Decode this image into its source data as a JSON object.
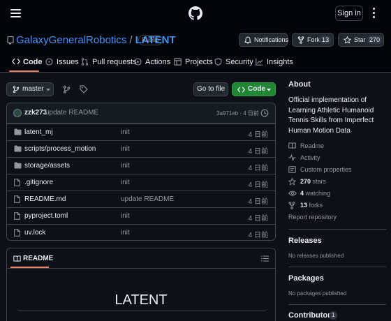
{
  "topbar": {
    "signin_label": "Sign in"
  },
  "repo": {
    "owner": "GalaxyGeneralRobotics",
    "separator": "/",
    "name": "LATENT",
    "visibility": "Public"
  },
  "header_buttons": {
    "notifications": "Notifications",
    "fork_label": "Fork",
    "fork_count": "13",
    "star_label": "Star",
    "star_count": "270"
  },
  "tabs": [
    {
      "label": "Code",
      "icon": "code-icon"
    },
    {
      "label": "Issues",
      "icon": "issue-icon"
    },
    {
      "label": "Pull requests",
      "icon": "pull-request-icon"
    },
    {
      "label": "Actions",
      "icon": "play-icon"
    },
    {
      "label": "Projects",
      "icon": "table-icon"
    },
    {
      "label": "Security",
      "icon": "shield-icon"
    },
    {
      "label": "Insights",
      "icon": "graph-icon"
    }
  ],
  "toolbar": {
    "branch": "master",
    "goto_file": "Go to file",
    "code_button": "Code"
  },
  "commit": {
    "author": "zzk273",
    "message": "update README",
    "hash": "3a971eb · 4 日前"
  },
  "files": [
    {
      "type": "folder",
      "name": "latent_mj",
      "message": "init",
      "date": "4 日前"
    },
    {
      "type": "folder",
      "name": "scripts/process_motion",
      "message": "init",
      "date": "4 日前"
    },
    {
      "type": "folder",
      "name": "storage/assets",
      "message": "init",
      "date": "4 日前"
    },
    {
      "type": "file",
      "name": ".gitignore",
      "message": "init",
      "date": "4 日前"
    },
    {
      "type": "file",
      "name": "README.md",
      "message": "update README",
      "date": "4 日前"
    },
    {
      "type": "file",
      "name": "pyproject.toml",
      "message": "init",
      "date": "4 日前"
    },
    {
      "type": "file",
      "name": "uv.lock",
      "message": "init",
      "date": "4 日前"
    }
  ],
  "readme": {
    "tab_label": "README",
    "title": "LATENT"
  },
  "about": {
    "heading": "About",
    "description": "Official implementation of Learning Athletic Humanoid Tennis Skills from Imperfect Human Motion Data",
    "links": [
      {
        "label": "Readme",
        "icon": "book-icon"
      },
      {
        "label": "Activity",
        "icon": "pulse-icon"
      },
      {
        "label": "Custom properties",
        "icon": "note-icon"
      }
    ],
    "stats": [
      {
        "value": "270",
        "label": "stars",
        "icon": "star-icon"
      },
      {
        "value": "4",
        "label": "watching",
        "icon": "eye-icon"
      },
      {
        "value": "13",
        "label": "forks",
        "icon": "fork-icon"
      }
    ],
    "report": "Report repository"
  },
  "releases": {
    "heading": "Releases",
    "note": "No releases published"
  },
  "packages": {
    "heading": "Packages",
    "note": "No packages published"
  },
  "contributors": {
    "heading": "Contributors",
    "count": "1"
  },
  "colors": {
    "accent": "#4493f8",
    "tab_underline": "#f78166",
    "green_button": "#238636",
    "bg": "#0d1117"
  }
}
